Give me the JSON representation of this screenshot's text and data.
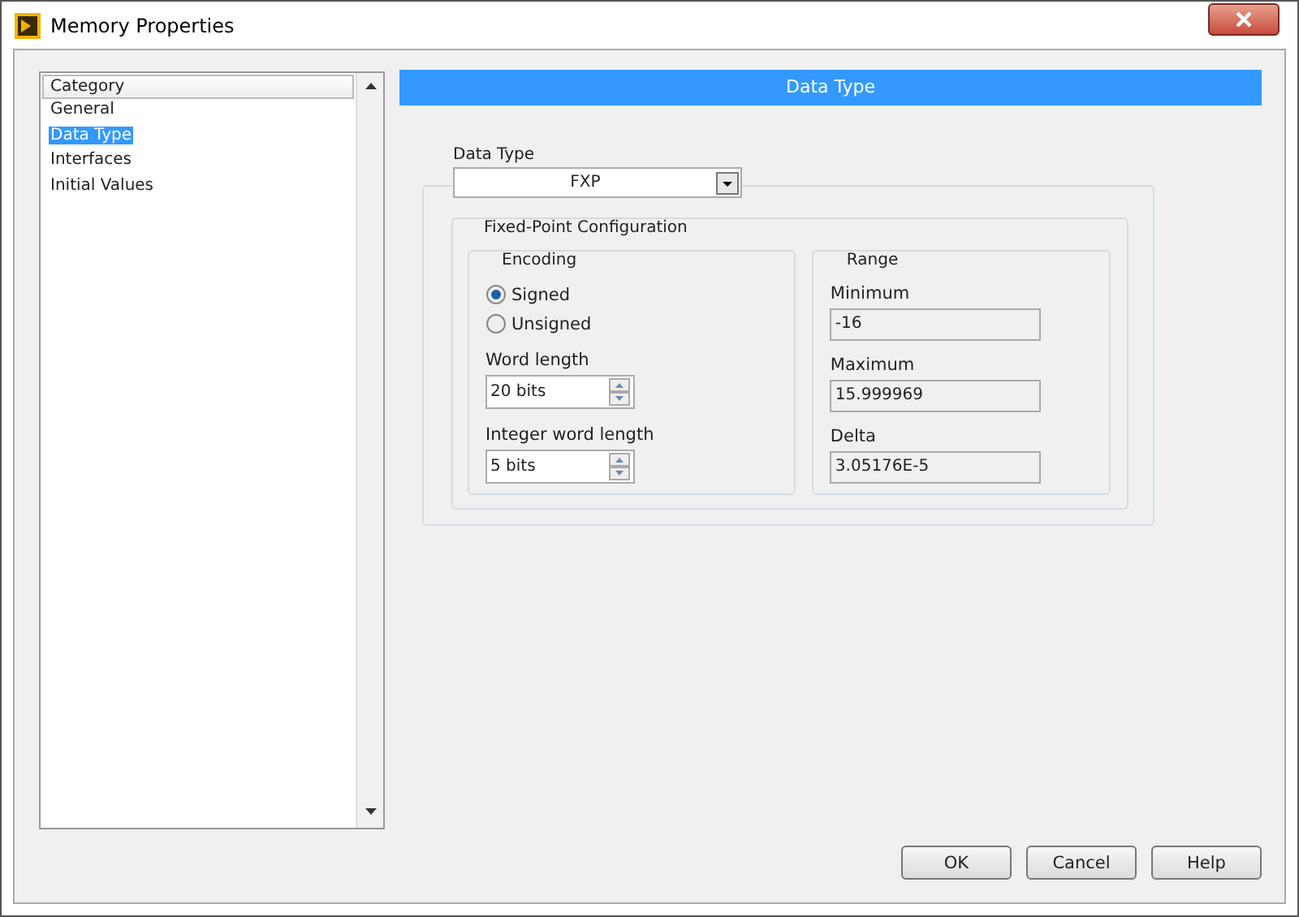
{
  "window": {
    "title": "Memory Properties"
  },
  "category_list": {
    "header": "Category",
    "items": [
      {
        "label": "General",
        "selected": false
      },
      {
        "label": "Data Type",
        "selected": true
      },
      {
        "label": "Interfaces",
        "selected": false
      },
      {
        "label": "Initial Values",
        "selected": false
      }
    ]
  },
  "panel_title": "Data Type",
  "data_type": {
    "label": "Data Type",
    "value": "FXP"
  },
  "fixed_point": {
    "legend": "Fixed-Point Configuration",
    "encoding": {
      "legend": "Encoding",
      "options": [
        {
          "label": "Signed",
          "selected": true
        },
        {
          "label": "Unsigned",
          "selected": false
        }
      ],
      "spinners": [
        {
          "label": "Word length",
          "value": "20 bits"
        },
        {
          "label": "Integer word length",
          "value": "5 bits"
        }
      ]
    },
    "range": {
      "legend": "Range",
      "fields": [
        {
          "label": "Minimum",
          "value": "-16"
        },
        {
          "label": "Maximum",
          "value": "15.999969"
        },
        {
          "label": "Delta",
          "value": "3.05176E-5"
        }
      ]
    }
  },
  "buttons": [
    "OK",
    "Cancel",
    "Help"
  ]
}
